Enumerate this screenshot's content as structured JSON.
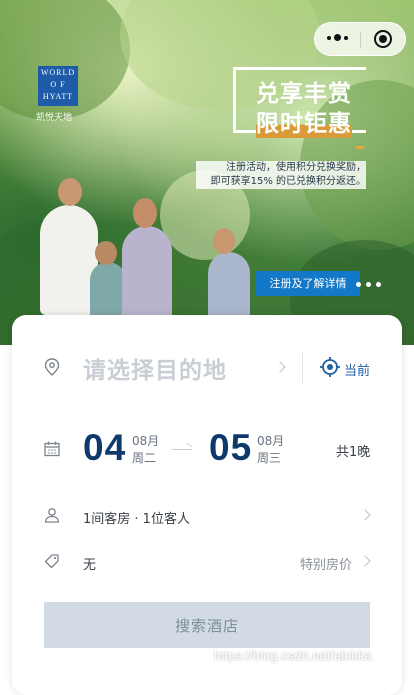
{
  "banner": {
    "brand_line1": "WORLD",
    "brand_line2": "O F",
    "brand_line3": "HYATT",
    "brand_sub": "凯悦天地",
    "headline1": "兑享丰赏",
    "headline2": "限时钜惠",
    "desc_line1": "注册活动，使用积分兑换奖励，",
    "desc_line2": "即可获享15% 的已兑换积分返还。",
    "cta": "注册及了解详情",
    "slide_count": 3
  },
  "capsule": {
    "more_icon": "more-dots-icon",
    "close_icon": "target-circle-icon"
  },
  "search_form": {
    "destination_placeholder": "请选择目的地",
    "current_location_label": "当前",
    "checkin": {
      "day": "04",
      "month": "08月",
      "weekday": "周二"
    },
    "checkout": {
      "day": "05",
      "month": "08月",
      "weekday": "周三"
    },
    "nights": "共1晚",
    "rooms_guests": "1间客房 · 1位客人",
    "rate_value": "无",
    "rate_label": "特别房价",
    "search_button": "搜索酒店"
  },
  "watermark": "https://blog.csdn.net/alokka",
  "colors": {
    "primary_blue": "#0e3a6b",
    "accent_blue": "#1f5fa6",
    "cta_blue": "#1478c8",
    "button_disabled": "#d2dbe3",
    "gold": "#e9a53c"
  }
}
